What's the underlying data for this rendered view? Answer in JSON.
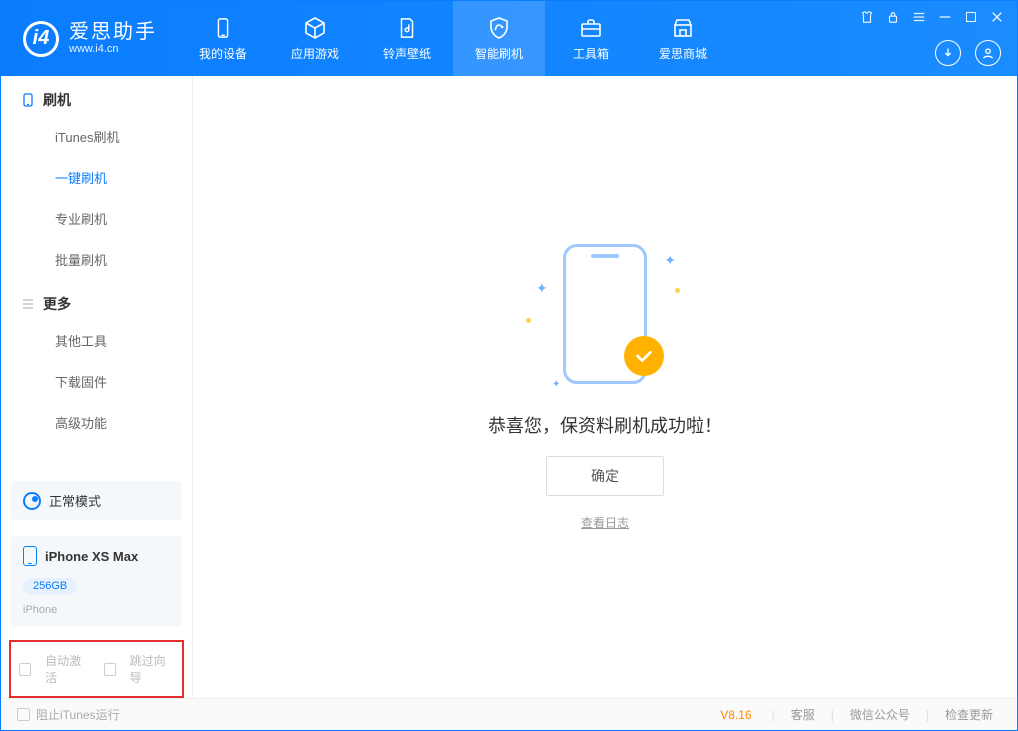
{
  "app": {
    "title": "爱思助手",
    "subtitle": "www.i4.cn"
  },
  "nav": {
    "items": [
      {
        "label": "我的设备"
      },
      {
        "label": "应用游戏"
      },
      {
        "label": "铃声壁纸"
      },
      {
        "label": "智能刷机"
      },
      {
        "label": "工具箱"
      },
      {
        "label": "爱思商城"
      }
    ],
    "active_index": 3
  },
  "sidebar": {
    "sections": [
      {
        "title": "刷机",
        "items": [
          "iTunes刷机",
          "一键刷机",
          "专业刷机",
          "批量刷机"
        ],
        "active_index": 1
      },
      {
        "title": "更多",
        "items": [
          "其他工具",
          "下载固件",
          "高级功能"
        ],
        "active_index": -1
      }
    ],
    "mode_label": "正常模式",
    "device": {
      "name": "iPhone XS Max",
      "storage": "256GB",
      "type": "iPhone"
    },
    "checkboxes": {
      "auto_activate": "自动激活",
      "skip_guide": "跳过向导"
    }
  },
  "main": {
    "success_text": "恭喜您，保资料刷机成功啦！",
    "confirm_label": "确定",
    "log_link_label": "查看日志"
  },
  "footer": {
    "block_itunes_label": "阻止iTunes运行",
    "version": "V8.16",
    "links": [
      "客服",
      "微信公众号",
      "检查更新"
    ]
  }
}
